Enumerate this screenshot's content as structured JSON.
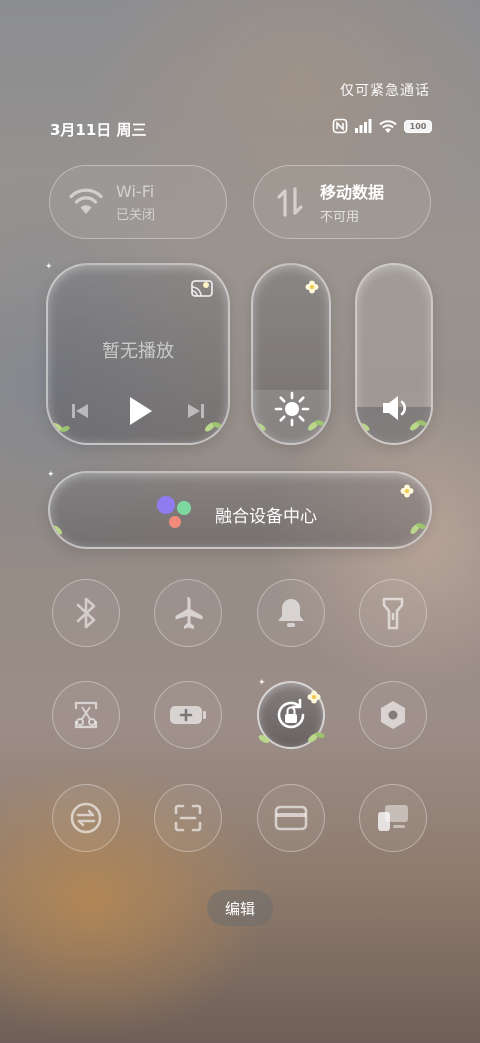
{
  "status_bar": {
    "emergency_text": "仅可紧急通话",
    "date": "3月11日 周三",
    "battery": "100"
  },
  "wifi": {
    "label": "Wi-Fi",
    "state": "已关闭"
  },
  "mobile_data": {
    "label": "移动数据",
    "state": "不可用"
  },
  "media": {
    "title": "暂无播放"
  },
  "brightness": {
    "level_percent": 30
  },
  "volume": {
    "level_percent": 20
  },
  "fusion_center": {
    "label": "融合设备中心"
  },
  "toggles": [
    {
      "name": "bluetooth",
      "icon": "bluetooth-icon"
    },
    {
      "name": "airplane-mode",
      "icon": "airplane-icon"
    },
    {
      "name": "ring-mode",
      "icon": "bell-icon"
    },
    {
      "name": "flashlight",
      "icon": "flashlight-icon"
    },
    {
      "name": "screenshot",
      "icon": "scissors-screenshot-icon"
    },
    {
      "name": "battery-saver",
      "icon": "battery-plus-icon"
    },
    {
      "name": "rotation-lock",
      "icon": "rotation-lock-icon",
      "active": true
    },
    {
      "name": "settings-hex",
      "icon": "hexagon-icon"
    },
    {
      "name": "device-switch",
      "icon": "sync-circle-icon"
    },
    {
      "name": "scan",
      "icon": "scan-icon"
    },
    {
      "name": "wallet",
      "icon": "card-icon"
    },
    {
      "name": "multi-device",
      "icon": "devices-icon"
    }
  ],
  "edit_button": {
    "label": "编辑"
  },
  "colors": {
    "accent_purple": "#8f7cf0",
    "accent_green": "#7fd8a0",
    "accent_red": "#f08a7a"
  }
}
